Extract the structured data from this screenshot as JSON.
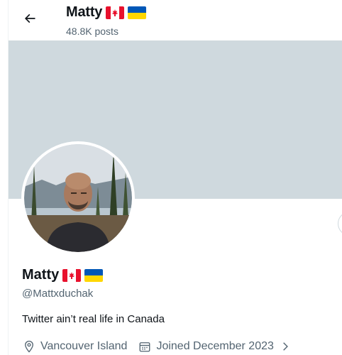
{
  "header": {
    "name": "Matty",
    "posts": "48.8K posts"
  },
  "profile": {
    "name": "Matty",
    "handle": "@Mattxduchak",
    "bio": "Twitter ain’t real life in Canada",
    "location": "Vancouver Island",
    "joined": "Joined December 2023"
  },
  "flags": [
    "canada-flag",
    "ukraine-flag"
  ],
  "icons": {
    "back": "arrow-left-icon",
    "location": "map-pin-icon",
    "calendar": "calendar-icon",
    "chevron": "chevron-right-icon"
  },
  "colors": {
    "banner": "#cfd9de",
    "secondary_text": "#536471",
    "primary_text": "#0f1419"
  }
}
